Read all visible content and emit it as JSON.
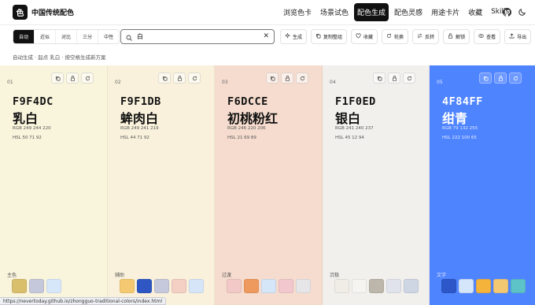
{
  "header": {
    "logo_char": "色",
    "brand": "中国传统配色",
    "nav": [
      {
        "label": "浏览色卡",
        "active": false
      },
      {
        "label": "场景试色",
        "active": false
      },
      {
        "label": "配色生成",
        "active": true
      },
      {
        "label": "配色灵感",
        "active": false
      },
      {
        "label": "用途卡片",
        "active": false
      },
      {
        "label": "收藏",
        "active": false
      },
      {
        "label": "Skills",
        "active": false
      }
    ],
    "icons": [
      "github-icon",
      "moon-icon"
    ]
  },
  "toolbar": {
    "modes": [
      {
        "label": "自动",
        "active": true
      },
      {
        "label": "近似",
        "active": false
      },
      {
        "label": "对比",
        "active": false
      },
      {
        "label": "三分",
        "active": false
      },
      {
        "label": "中性",
        "active": false
      }
    ],
    "search": {
      "value": "白",
      "placeholder": ""
    },
    "actions": [
      {
        "label": "生成",
        "icon": "sparkle-icon"
      },
      {
        "label": "复制整组",
        "icon": "copy-icon"
      },
      {
        "label": "收藏",
        "icon": "heart-icon"
      },
      {
        "label": "轮换",
        "icon": "rotate-icon"
      },
      {
        "label": "反转",
        "icon": "swap-icon"
      },
      {
        "label": "解锁",
        "icon": "unlock-icon"
      },
      {
        "label": "查看",
        "icon": "eye-icon"
      },
      {
        "label": "导出",
        "icon": "export-icon"
      }
    ]
  },
  "subline": "自动生成 · 起点 乳白 · 按空格生成新方案",
  "cards": [
    {
      "index": "01",
      "hex": "F9F4DC",
      "name": "乳白",
      "rgb": "RGB 249 244 220",
      "hsl": "HSL 50 71 92",
      "role": "主色",
      "bg": "#F9F4DC",
      "dark": false,
      "swatches": [
        "#D9BE6C",
        "#C5C8DA",
        "#D7E7FA"
      ]
    },
    {
      "index": "02",
      "hex": "F9F1DB",
      "name": "蛑肉白",
      "rgb": "RGB 249 241 219",
      "hsl": "HSL 44 71 92",
      "role": "辅助",
      "bg": "#F9F1DB",
      "dark": false,
      "swatches": [
        "#F5C971",
        "#2E57C4",
        "#C6C8DB",
        "#F4CFC4",
        "#D6E6F8"
      ]
    },
    {
      "index": "03",
      "hex": "F6DCCE",
      "name": "初桃粉红",
      "rgb": "RGB 246 220 206",
      "hsl": "HSL 21 69 89",
      "role": "过渡",
      "bg": "#F6DCCE",
      "dark": false,
      "swatches": [
        "#F2C9C6",
        "#EE9A5F",
        "#D5E6F8",
        "#F2C8CE",
        "#E6E5E8"
      ]
    },
    {
      "index": "04",
      "hex": "F1F0ED",
      "name": "银白",
      "rgb": "RGB 241 240 237",
      "hsl": "HSL 45 12 94",
      "role": "沉稳",
      "bg": "#F1F0ED",
      "dark": false,
      "swatches": [
        "#F0EDE6",
        "#F6F4F1",
        "#BDB6AB",
        "#E1E3EC",
        "#CFD6E3"
      ]
    },
    {
      "index": "05",
      "hex": "4F84FF",
      "name": "绀青",
      "rgb": "RGB 79 132 255",
      "hsl": "HSL 222 100 65",
      "role": "文字",
      "bg": "#4F84FF",
      "dark": true,
      "swatches": [
        "#2D57C8",
        "#D6E6FA",
        "#F4B43C",
        "#F3C872",
        "#5DC3C8"
      ]
    }
  ],
  "status_url": "https://nevertoday.github.io/zhongguo-traditional-colors/index.html"
}
